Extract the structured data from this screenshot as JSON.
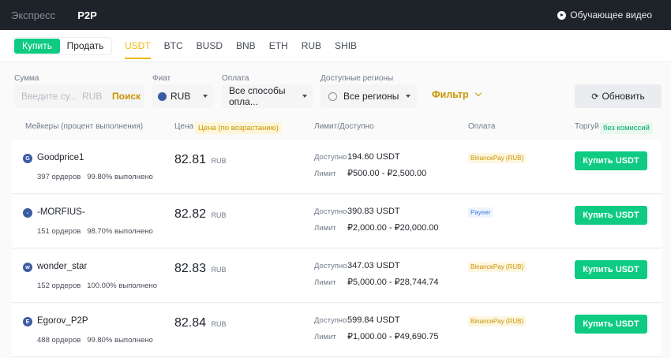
{
  "topbar": {
    "tabs": [
      {
        "label": "Экспресс"
      },
      {
        "label": "P2P"
      }
    ],
    "video_label": "Обучающее видео"
  },
  "trade": {
    "buy_label": "Купить",
    "sell_label": "Продать",
    "assets": [
      "USDT",
      "BTC",
      "BUSD",
      "BNB",
      "ETH",
      "RUB",
      "SHIB"
    ],
    "active_asset": "USDT"
  },
  "filters": {
    "amount_label": "Сумма",
    "amount_placeholder": "Введите су...",
    "amount_currency": "RUB",
    "search_label": "Поиск",
    "fiat_label": "Фиат",
    "fiat_value": "RUB",
    "payment_label": "Оплата",
    "payment_value": "Все способы опла...",
    "region_label": "Доступные регионы",
    "region_value": "Все регионы",
    "filter_label": "Фильтр",
    "refresh_label": "Обновить"
  },
  "table": {
    "col_makers": "Мейкеры (процент выполнения)",
    "col_price": "Цена",
    "col_price_badge": "Цена (по возрастанию)",
    "col_limit": "Лимит/Доступно",
    "col_payment": "Оплата",
    "col_trade": "Торгуй",
    "col_trade_badge": "без комиссий",
    "available_key": "Доступно",
    "limit_key": "Лимит",
    "buy_button": "Купить USDT",
    "rows": [
      {
        "avatar": "G",
        "name": "Goodprice1",
        "stats": "397 ордеров   99.80% выполнено",
        "price": "82.81",
        "currency": "RUB",
        "available": "194.60 USDT",
        "limit": "₽500.00 - ₽2,500.00",
        "payment": "BinancePay (RUB)",
        "payment_style": "yellow"
      },
      {
        "avatar": "-",
        "name": "-MORFIUS-",
        "stats": "151 ордеров   98.70% выполнено",
        "price": "82.82",
        "currency": "RUB",
        "available": "390.83 USDT",
        "limit": "₽2,000.00 - ₽20,000.00",
        "payment": "Payeer",
        "payment_style": "blue"
      },
      {
        "avatar": "w",
        "name": "wonder_star",
        "stats": "152 ордеров   100.00% выполнено",
        "price": "82.83",
        "currency": "RUB",
        "available": "347.03 USDT",
        "limit": "₽5,000.00 - ₽28,744.74",
        "payment": "BinancePay (RUB)",
        "payment_style": "yellow"
      },
      {
        "avatar": "E",
        "name": "Egorov_P2P",
        "stats": "488 ордеров   99.80% выполнено",
        "price": "82.84",
        "currency": "RUB",
        "available": "599.84 USDT",
        "limit": "₽1,000.00 - ₽49,690.75",
        "payment": "BinancePay (RUB)",
        "payment_style": "yellow"
      }
    ]
  }
}
